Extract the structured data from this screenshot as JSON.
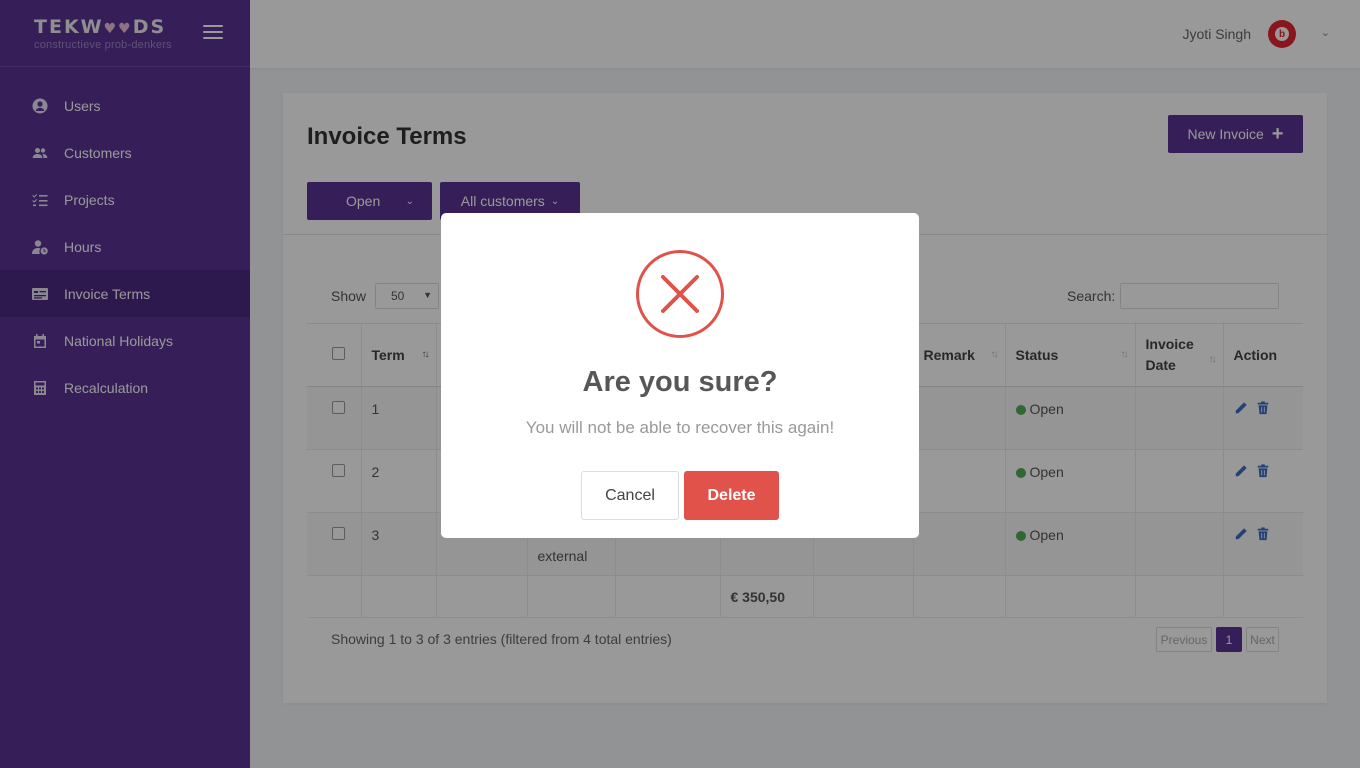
{
  "brand": {
    "name_left": "TEKW",
    "name_hearts": "♥♥",
    "name_right": "DS",
    "tagline": "constructieve prob-denkers"
  },
  "sidebar": {
    "items": [
      {
        "label": "Users",
        "icon": "user-circle-icon"
      },
      {
        "label": "Customers",
        "icon": "people-icon"
      },
      {
        "label": "Projects",
        "icon": "checklist-icon"
      },
      {
        "label": "Hours",
        "icon": "user-clock-icon"
      },
      {
        "label": "Invoice Terms",
        "icon": "invoice-icon",
        "active": true
      },
      {
        "label": "National Holidays",
        "icon": "calendar-icon"
      },
      {
        "label": "Recalculation",
        "icon": "calculator-icon"
      }
    ]
  },
  "topbar": {
    "user_name": "Jyoti Singh",
    "avatar_letter": "b"
  },
  "page": {
    "title": "Invoice Terms",
    "new_button": "New Invoice",
    "filter_status": "Open",
    "filter_customer": "All customers",
    "show_label": "Show",
    "show_value": "50",
    "search_label": "Search:"
  },
  "table": {
    "columns": [
      "Term",
      "",
      "",
      "",
      "",
      "",
      "Remark",
      "Status",
      "Invoice Date",
      "Action"
    ],
    "rows": [
      {
        "term": "1",
        "c3": "",
        "c4": "",
        "c5": "",
        "c6": "",
        "remark": "",
        "status": "Open",
        "invoice_date": ""
      },
      {
        "term": "2",
        "c3": "",
        "c4": "",
        "c5": "",
        "c6": "",
        "remark": "",
        "status": "Open",
        "invoice_date": ""
      },
      {
        "term": "3",
        "c3": "",
        "c4": "external",
        "c5": "",
        "c6": "",
        "remark": "",
        "status": "Open",
        "invoice_date": ""
      }
    ],
    "total": "€ 350,50"
  },
  "footer": {
    "info": "Showing 1 to 3 of 3 entries (filtered from 4 total entries)",
    "prev": "Previous",
    "page": "1",
    "next": "Next"
  },
  "modal": {
    "title": "Are you sure?",
    "text": "You will not be able to recover this again!",
    "cancel": "Cancel",
    "delete": "Delete",
    "icon": "error-x-icon",
    "accent_color": "#e0524a"
  },
  "colors": {
    "brand": "#5a3494",
    "status_open": "#4caf50"
  }
}
